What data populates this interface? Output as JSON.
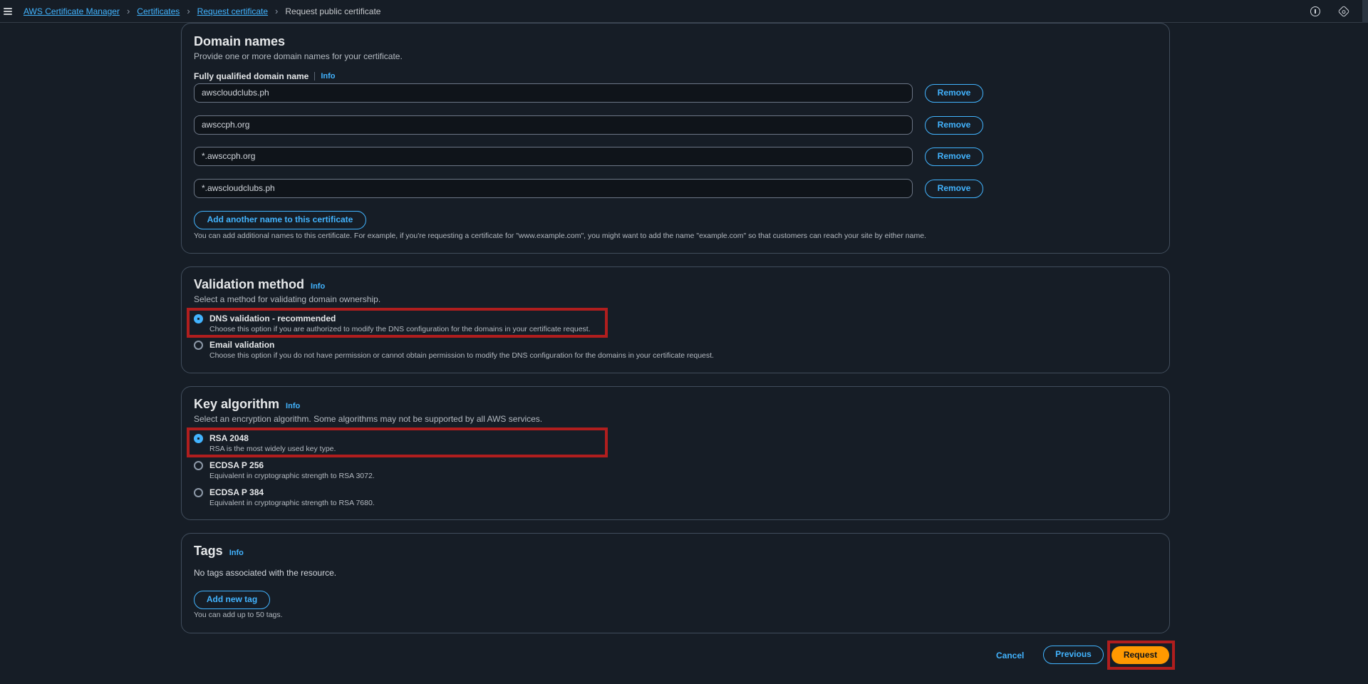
{
  "breadcrumb": {
    "items": [
      "AWS Certificate Manager",
      "Certificates",
      "Request certificate"
    ],
    "current": "Request public certificate"
  },
  "domain_names": {
    "title": "Domain names",
    "description": "Provide one or more domain names for your certificate.",
    "field_label": "Fully qualified domain name",
    "info_label": "Info",
    "values": [
      "awscloudclubs.ph",
      "awsccph.org",
      "*.awsccph.org",
      "*.awscloudclubs.ph"
    ],
    "remove_label": "Remove",
    "add_label": "Add another name to this certificate",
    "help_text": "You can add additional names to this certificate. For example, if you're requesting a certificate for \"www.example.com\", you might want to add the name \"example.com\" so that customers can reach your site by either name."
  },
  "validation": {
    "title": "Validation method",
    "info_label": "Info",
    "description": "Select a method for validating domain ownership.",
    "options": [
      {
        "label": "DNS validation - recommended",
        "desc": "Choose this option if you are authorized to modify the DNS configuration for the domains in your certificate request.",
        "selected": true
      },
      {
        "label": "Email validation",
        "desc": "Choose this option if you do not have permission or cannot obtain permission to modify the DNS configuration for the domains in your certificate request.",
        "selected": false
      }
    ]
  },
  "key_algorithm": {
    "title": "Key algorithm",
    "info_label": "Info",
    "description": "Select an encryption algorithm. Some algorithms may not be supported by all AWS services.",
    "options": [
      {
        "label": "RSA 2048",
        "desc": "RSA is the most widely used key type.",
        "selected": true
      },
      {
        "label": "ECDSA P 256",
        "desc": "Equivalent in cryptographic strength to RSA 3072.",
        "selected": false
      },
      {
        "label": "ECDSA P 384",
        "desc": "Equivalent in cryptographic strength to RSA 7680.",
        "selected": false
      }
    ]
  },
  "tags": {
    "title": "Tags",
    "info_label": "Info",
    "empty_text": "No tags associated with the resource.",
    "add_label": "Add new tag",
    "help_text": "You can add up to 50 tags."
  },
  "footer": {
    "cancel_label": "Cancel",
    "previous_label": "Previous",
    "request_label": "Request"
  },
  "colors": {
    "background": "#161d26",
    "accent": "#42b4ff",
    "primary": "#ff9900",
    "highlight": "#b01e1e"
  }
}
